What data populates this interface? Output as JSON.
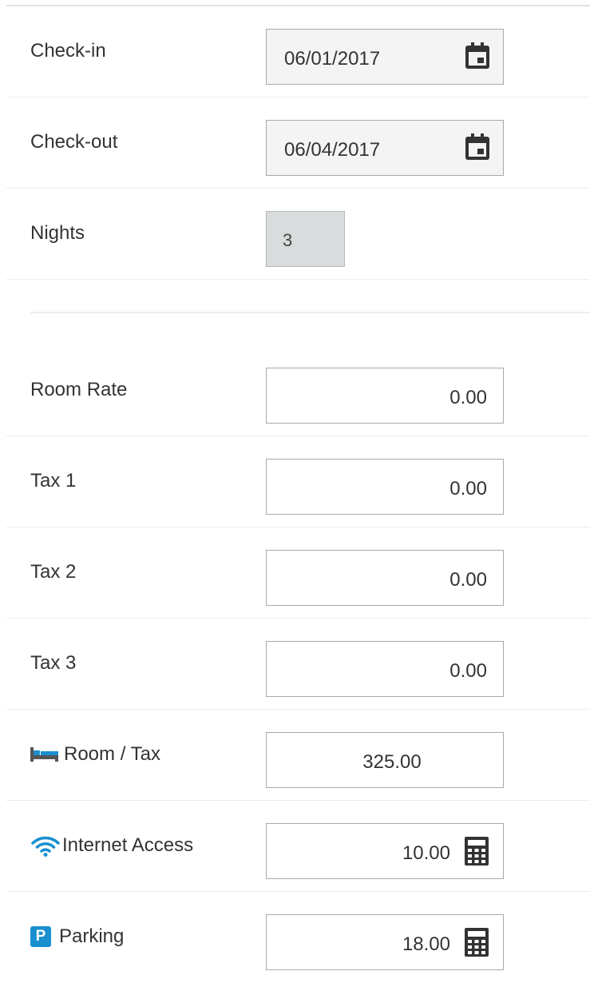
{
  "checkin": {
    "label": "Check-in",
    "value": "06/01/2017",
    "icon": "calendar-icon"
  },
  "checkout": {
    "label": "Check-out",
    "value": "06/04/2017",
    "icon": "calendar-icon"
  },
  "nights": {
    "label": "Nights",
    "value": "3"
  },
  "room_rate": {
    "label": "Room Rate",
    "value": "0.00"
  },
  "tax1": {
    "label": "Tax 1",
    "value": "0.00"
  },
  "tax2": {
    "label": "Tax 2",
    "value": "0.00"
  },
  "tax3": {
    "label": "Tax 3",
    "value": "0.00"
  },
  "room_tax": {
    "label": "Room / Tax",
    "value": "325.00",
    "icon": "bed-icon"
  },
  "internet": {
    "label": "Internet Access",
    "value": "10.00",
    "icon": "wifi-icon",
    "action_icon": "calculator-icon"
  },
  "parking": {
    "label": "Parking",
    "value": "18.00",
    "icon": "parking-icon",
    "icon_text": "P",
    "action_icon": "calculator-icon"
  },
  "colors": {
    "accent": "#1a8fd0",
    "icon_dark": "#333333",
    "readonly_bg": "#d9dcdd",
    "date_bg": "#f4f4f4"
  }
}
